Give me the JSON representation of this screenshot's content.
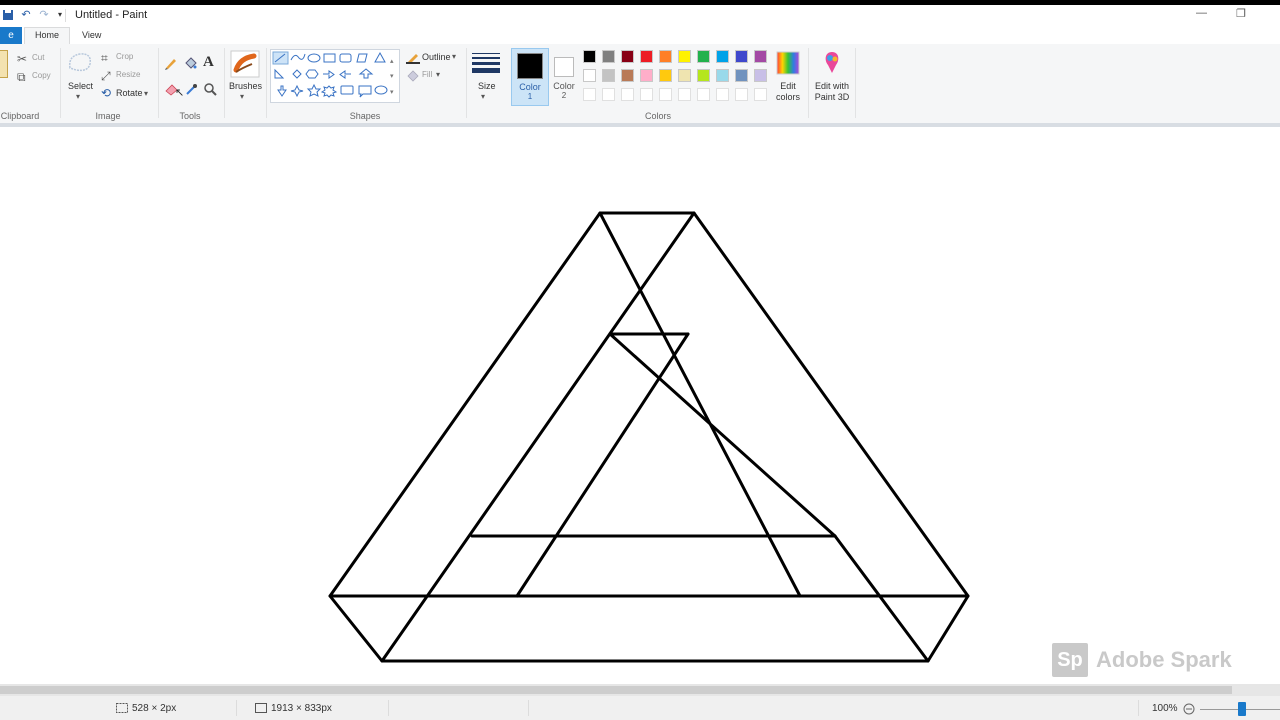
{
  "window": {
    "title": "Untitled - Paint",
    "minimize_glyph": "—",
    "restore_glyph": "❐"
  },
  "tabs": {
    "file_label": "e",
    "home_label": "Home",
    "view_label": "View"
  },
  "ribbon": {
    "clipboard": {
      "group_label": "Clipboard",
      "cut_label": "Cut",
      "copy_label": "Copy"
    },
    "image": {
      "group_label": "Image",
      "select_label": "Select",
      "crop_label": "Crop",
      "resize_label": "Resize",
      "rotate_label": "Rotate"
    },
    "tools": {
      "group_label": "Tools"
    },
    "brushes": {
      "label": "Brushes"
    },
    "shapes": {
      "group_label": "Shapes",
      "outline_label": "Outline",
      "fill_label": "Fill"
    },
    "size": {
      "label": "Size"
    },
    "color1": {
      "label_line1": "Color",
      "label_line2": "1",
      "color": "#000000"
    },
    "color2": {
      "label_line1": "Color",
      "label_line2": "2",
      "color": "#ffffff"
    },
    "colors": {
      "group_label": "Colors"
    },
    "edit_colors": {
      "line1": "Edit",
      "line2": "colors"
    },
    "paint3d": {
      "line1": "Edit with",
      "line2": "Paint 3D"
    },
    "palette_row1": [
      "#000000",
      "#7f7f7f",
      "#880015",
      "#ed1c24",
      "#ff7f27",
      "#fff200",
      "#22b14c",
      "#00a2e8",
      "#3f48cc",
      "#a349a4"
    ],
    "palette_row2": [
      "#ffffff",
      "#c3c3c3",
      "#b97a57",
      "#ffaec9",
      "#ffc90e",
      "#efe4b0",
      "#b5e61d",
      "#99d9ea",
      "#7092be",
      "#c8bfe7"
    ]
  },
  "status": {
    "selection_size": "528 × 2px",
    "image_size": "1913 × 833px",
    "zoom": "100%"
  },
  "watermark": {
    "logo": "Sp",
    "text": "Adobe Spark"
  }
}
